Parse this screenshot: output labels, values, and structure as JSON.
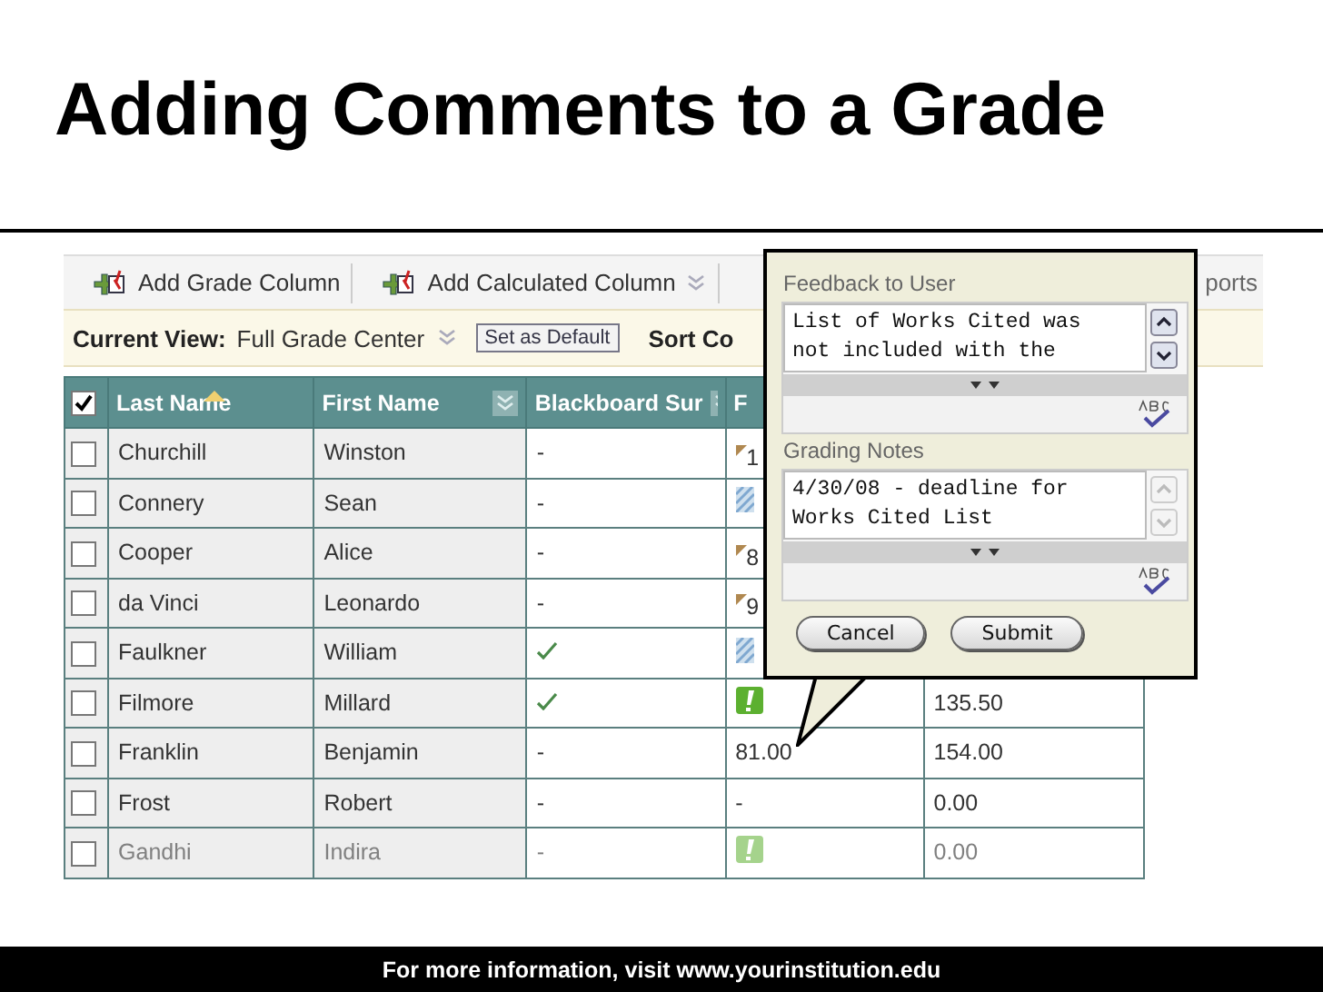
{
  "slide": {
    "title": "Adding Comments to a Grade",
    "footer": "For more information, visit www.yourinstitution.edu"
  },
  "toolbar": {
    "buttons": [
      {
        "label": "Add Grade Column",
        "menu": false
      },
      {
        "label": "Add Calculated Column",
        "menu": true
      }
    ],
    "right_fragment": "ports"
  },
  "view_bar": {
    "label": "Current View:",
    "value": "Full Grade Center",
    "button": "Set as Default",
    "sort_fragment": "Sort Co"
  },
  "table": {
    "select_all_checked": true,
    "columns": [
      {
        "label": "Last Name",
        "sorted": true,
        "menu": false
      },
      {
        "label": "First Name",
        "sorted": false,
        "menu": true
      },
      {
        "label": "Blackboard Sur",
        "sorted": false,
        "menu": true
      },
      {
        "label": "F"
      }
    ],
    "rows": [
      {
        "checked": false,
        "faded": false,
        "cells": [
          {
            "kind": "text",
            "text": "Churchill"
          },
          {
            "kind": "text",
            "text": "Winston"
          },
          {
            "kind": "text",
            "text": "-"
          },
          {
            "kind": "flag",
            "text": "1"
          }
        ]
      },
      {
        "checked": false,
        "faded": false,
        "cells": [
          {
            "kind": "text",
            "text": "Connery"
          },
          {
            "kind": "text",
            "text": "Sean"
          },
          {
            "kind": "text",
            "text": "-"
          },
          {
            "kind": "pending"
          }
        ]
      },
      {
        "checked": false,
        "faded": false,
        "cells": [
          {
            "kind": "text",
            "text": "Cooper"
          },
          {
            "kind": "text",
            "text": "Alice"
          },
          {
            "kind": "text",
            "text": "-"
          },
          {
            "kind": "flag",
            "text": "8"
          }
        ]
      },
      {
        "checked": false,
        "faded": false,
        "cells": [
          {
            "kind": "text",
            "text": "da Vinci"
          },
          {
            "kind": "text",
            "text": "Leonardo"
          },
          {
            "kind": "text",
            "text": "-"
          },
          {
            "kind": "flag",
            "text": "9"
          }
        ]
      },
      {
        "checked": false,
        "faded": false,
        "cells": [
          {
            "kind": "text",
            "text": "Faulkner"
          },
          {
            "kind": "text",
            "text": "William"
          },
          {
            "kind": "check"
          },
          {
            "kind": "pending"
          }
        ]
      },
      {
        "checked": false,
        "faded": false,
        "cells": [
          {
            "kind": "text",
            "text": "Filmore"
          },
          {
            "kind": "text",
            "text": "Millard"
          },
          {
            "kind": "check"
          },
          {
            "kind": "alert"
          },
          {
            "kind": "text",
            "text": "135.50"
          }
        ]
      },
      {
        "checked": false,
        "faded": false,
        "cells": [
          {
            "kind": "text",
            "text": "Franklin"
          },
          {
            "kind": "text",
            "text": "Benjamin"
          },
          {
            "kind": "text",
            "text": "-"
          },
          {
            "kind": "text",
            "text": "81.00"
          },
          {
            "kind": "text",
            "text": "154.00"
          }
        ]
      },
      {
        "checked": false,
        "faded": false,
        "cells": [
          {
            "kind": "text",
            "text": "Frost"
          },
          {
            "kind": "text",
            "text": "Robert"
          },
          {
            "kind": "text",
            "text": "-"
          },
          {
            "kind": "text",
            "text": "-"
          },
          {
            "kind": "text",
            "text": "0.00"
          }
        ]
      },
      {
        "checked": false,
        "faded": true,
        "cells": [
          {
            "kind": "text",
            "text": "Gandhi"
          },
          {
            "kind": "text",
            "text": "Indira"
          },
          {
            "kind": "text",
            "text": "-"
          },
          {
            "kind": "alert"
          },
          {
            "kind": "text",
            "text": "0.00"
          }
        ]
      }
    ]
  },
  "popup": {
    "sections": [
      {
        "label": "Feedback to User",
        "text": "List of Works Cited was\nnot included with the",
        "scroll_disabled": false
      },
      {
        "label": "Grading Notes",
        "text": "4/30/08 - deadline for\nWorks Cited List",
        "scroll_disabled": true
      }
    ],
    "buttons": [
      "Cancel",
      "Submit"
    ]
  }
}
